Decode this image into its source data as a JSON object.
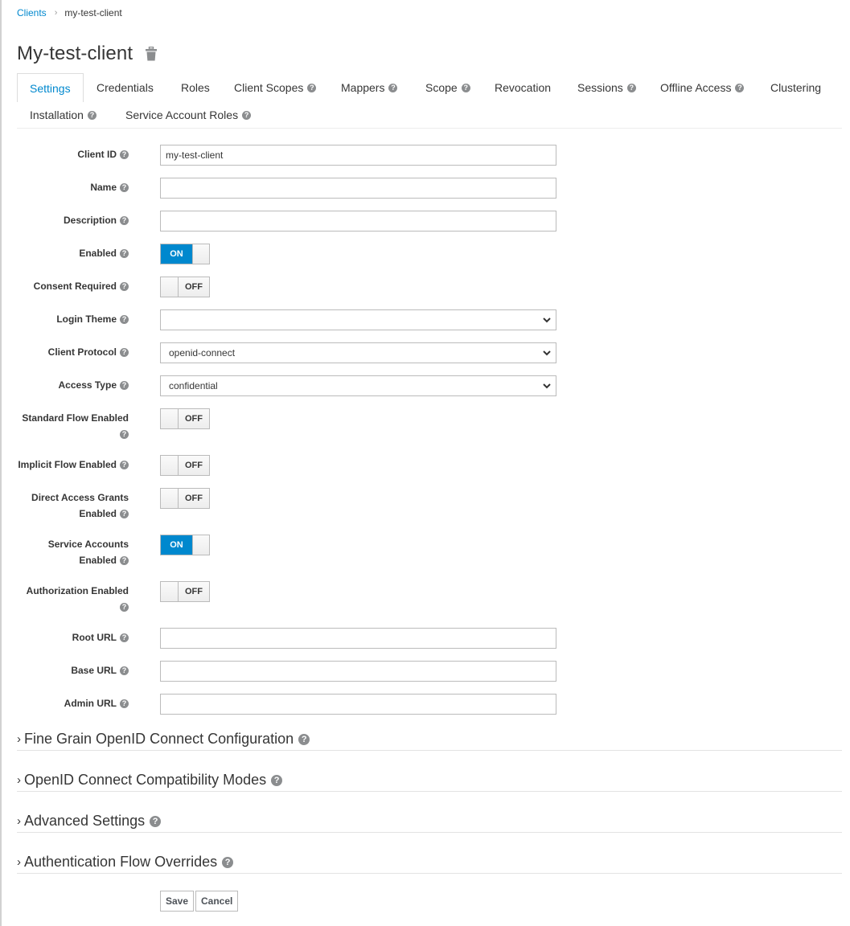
{
  "breadcrumb": {
    "parent": "Clients",
    "separator": "›",
    "current": "my-test-client"
  },
  "header": {
    "title": "My-test-client",
    "delete_icon": "trash-icon"
  },
  "tabs": [
    {
      "label": "Settings",
      "active": true,
      "help": false
    },
    {
      "label": "Credentials",
      "help": false
    },
    {
      "label": "Roles",
      "help": false
    },
    {
      "label": "Client Scopes",
      "help": true
    },
    {
      "label": "Mappers",
      "help": true
    },
    {
      "label": "Scope",
      "help": true
    },
    {
      "label": "Revocation",
      "help": false
    },
    {
      "label": "Sessions",
      "help": true
    },
    {
      "label": "Offline Access",
      "help": true
    },
    {
      "label": "Clustering",
      "help": false
    },
    {
      "label": "Installation",
      "help": true
    },
    {
      "label": "Service Account Roles",
      "help": true
    }
  ],
  "help_glyph": "?",
  "form": {
    "client_id": {
      "label": "Client ID",
      "value": "my-test-client"
    },
    "name": {
      "label": "Name",
      "value": ""
    },
    "description": {
      "label": "Description",
      "value": ""
    },
    "enabled": {
      "label": "Enabled",
      "state": "ON"
    },
    "consent_required": {
      "label": "Consent Required",
      "state": "OFF"
    },
    "login_theme": {
      "label": "Login Theme",
      "value": ""
    },
    "client_protocol": {
      "label": "Client Protocol",
      "value": "openid-connect"
    },
    "access_type": {
      "label": "Access Type",
      "value": "confidential"
    },
    "standard_flow": {
      "label_line1": "Standard Flow Enabled",
      "label_line2": "",
      "state": "OFF"
    },
    "implicit_flow": {
      "label": "Implicit Flow Enabled",
      "state": "OFF"
    },
    "direct_access": {
      "label_line1": "Direct Access Grants",
      "label_line2": "Enabled",
      "state": "OFF"
    },
    "service_accounts": {
      "label_line1": "Service Accounts",
      "label_line2": "Enabled",
      "state": "ON"
    },
    "authorization": {
      "label_line1": "Authorization Enabled",
      "label_line2": "",
      "state": "OFF"
    },
    "root_url": {
      "label": "Root URL",
      "value": ""
    },
    "base_url": {
      "label": "Base URL",
      "value": ""
    },
    "admin_url": {
      "label": "Admin URL",
      "value": ""
    }
  },
  "sections": [
    {
      "label": "Fine Grain OpenID Connect Configuration"
    },
    {
      "label": "OpenID Connect Compatibility Modes"
    },
    {
      "label": "Advanced Settings"
    },
    {
      "label": "Authentication Flow Overrides"
    }
  ],
  "section_caret": "›",
  "actions": {
    "save": "Save",
    "cancel": "Cancel"
  },
  "colors": {
    "accent": "#0088ce",
    "text": "#363636",
    "help_icon": "#8b8d8f"
  }
}
